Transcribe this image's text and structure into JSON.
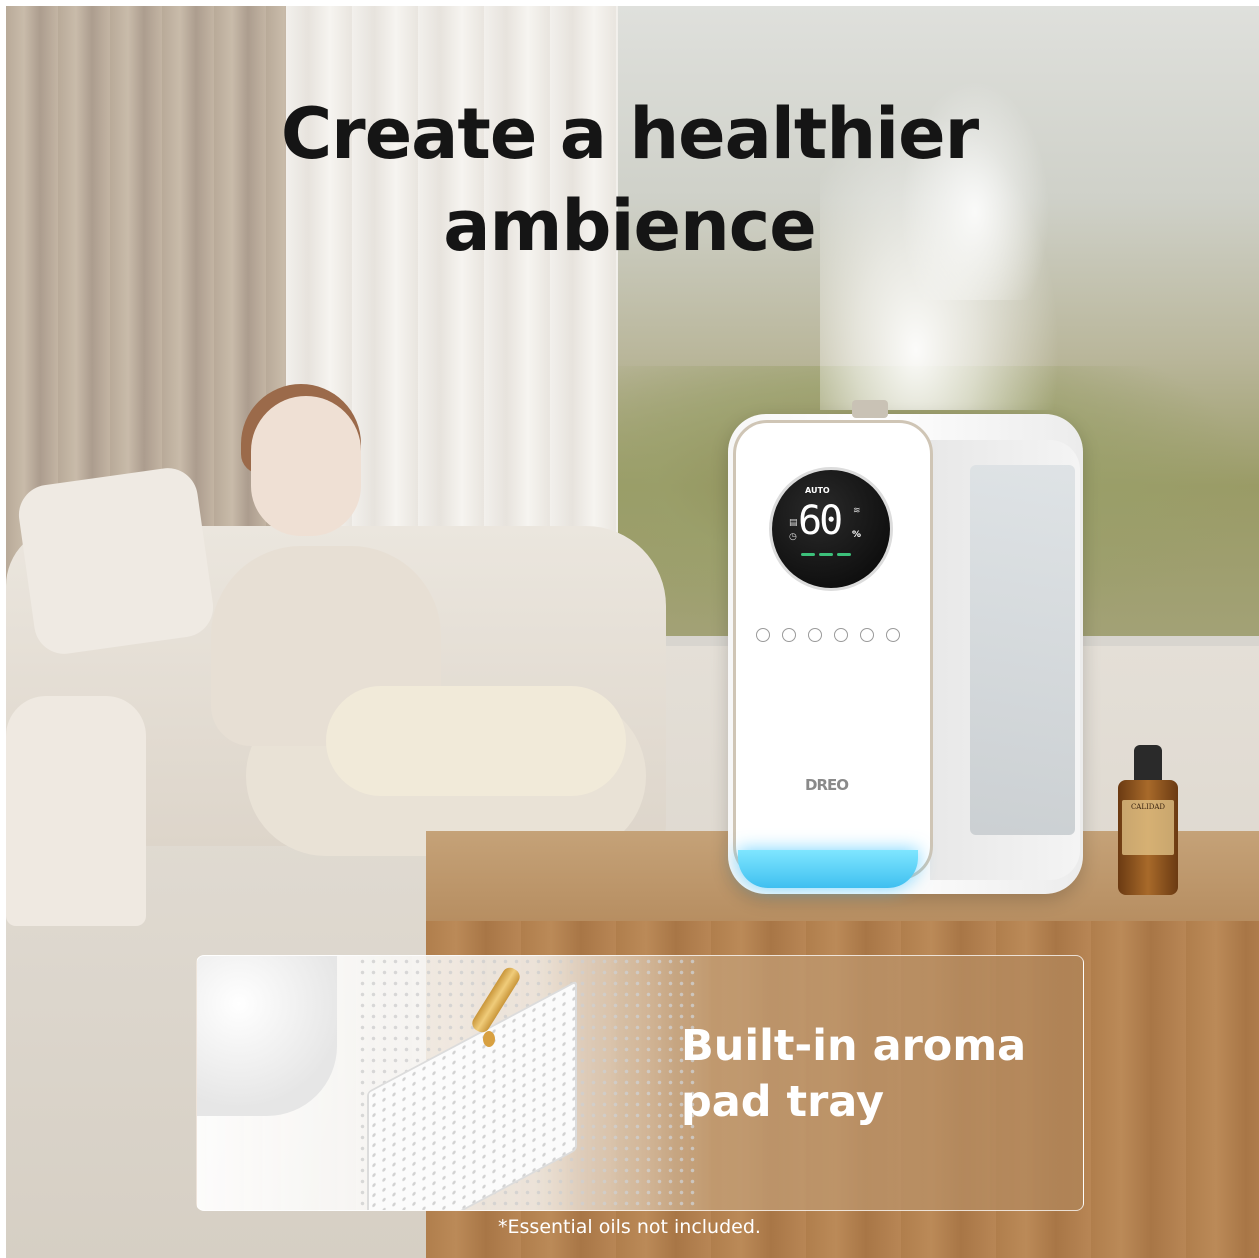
{
  "headline": {
    "line1": "Create a healthier",
    "line2": "ambience"
  },
  "device": {
    "brand": "DREO",
    "display": {
      "mode": "AUTO",
      "humidity_value": "60",
      "unit": "%"
    },
    "control_icons": [
      "power-icon",
      "timer-icon",
      "humidity-icon",
      "auto-icon",
      "sleep-icon",
      "light-icon"
    ],
    "glow_color": "#4cc9f5"
  },
  "bottle": {
    "brand": "CALIDAD"
  },
  "inset": {
    "title_line1": "Built-in aroma",
    "title_line2": "pad tray"
  },
  "footnote": "*Essential oils not included."
}
